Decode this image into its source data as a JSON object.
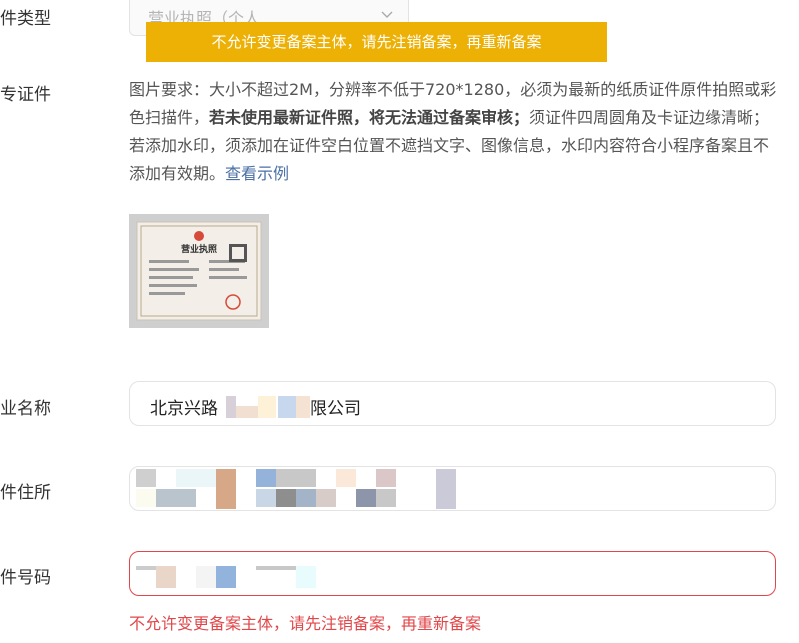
{
  "labels": {
    "cert_type": "件类型",
    "cert_doc": "专证件",
    "company_name": "业名称",
    "address": "件住所",
    "cert_number": "件号码"
  },
  "cert_type_select": {
    "value": "营业执照（个人..."
  },
  "toast": {
    "text": "不允许变更备案主体，请先注销备案，再重新备案"
  },
  "requirements": {
    "part1": "图片要求：大小不超过2M，分辨率不低于720*1280，必须为最新的纸质证件原件拍照或彩色扫描件，",
    "bold": "若未使用最新证件照，将无法通过备案审核；",
    "part2": "须证件四周圆角及卡证边缘清晰；若添加水印，须添加在证件空白位置不遮挡文字、图像信息，水印内容符合小程序备案且不添加有效期。",
    "link": "查看示例"
  },
  "license_image": {
    "title": "营业执照"
  },
  "company_name": {
    "prefix": "北京兴路",
    "suffix": "限公司"
  },
  "error_message": "不允许变更备案主体，请先注销备案，再重新备案",
  "colors": {
    "toast": "#edb005",
    "error": "#e0474a",
    "link": "#4a6fa5"
  }
}
